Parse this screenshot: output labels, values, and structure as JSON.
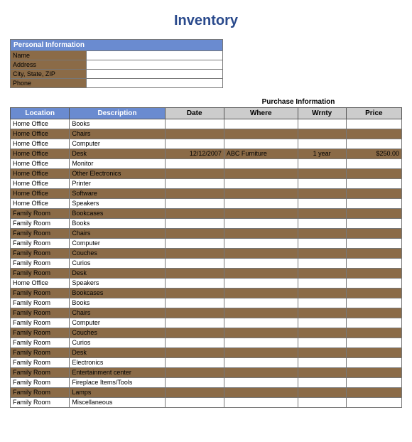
{
  "title": "Inventory",
  "personal_info": {
    "header": "Personal Information",
    "fields": [
      {
        "label": "Name",
        "value": ""
      },
      {
        "label": "Address",
        "value": ""
      },
      {
        "label": "City, State, ZIP",
        "value": ""
      },
      {
        "label": "Phone",
        "value": ""
      }
    ]
  },
  "purchase_info_header": "Purchase Information",
  "columns": {
    "location": "Location",
    "description": "Description",
    "date": "Date",
    "where": "Where",
    "wrnty": "Wrnty",
    "price": "Price"
  },
  "rows": [
    {
      "location": "Home Office",
      "description": "Books",
      "date": "",
      "where": "",
      "wrnty": "",
      "price": ""
    },
    {
      "location": "Home Office",
      "description": "Chairs",
      "date": "",
      "where": "",
      "wrnty": "",
      "price": ""
    },
    {
      "location": "Home Office",
      "description": "Computer",
      "date": "",
      "where": "",
      "wrnty": "",
      "price": ""
    },
    {
      "location": "Home Office",
      "description": "Desk",
      "date": "12/12/2007",
      "where": "ABC Furniture",
      "wrnty": "1 year",
      "price": "$250.00"
    },
    {
      "location": "Home Office",
      "description": "Monitor",
      "date": "",
      "where": "",
      "wrnty": "",
      "price": ""
    },
    {
      "location": "Home Office",
      "description": "Other Electronics",
      "date": "",
      "where": "",
      "wrnty": "",
      "price": ""
    },
    {
      "location": "Home Office",
      "description": "Printer",
      "date": "",
      "where": "",
      "wrnty": "",
      "price": ""
    },
    {
      "location": "Home Office",
      "description": "Software",
      "date": "",
      "where": "",
      "wrnty": "",
      "price": ""
    },
    {
      "location": "Home Office",
      "description": "Speakers",
      "date": "",
      "where": "",
      "wrnty": "",
      "price": ""
    },
    {
      "location": "Family Room",
      "description": "Bookcases",
      "date": "",
      "where": "",
      "wrnty": "",
      "price": ""
    },
    {
      "location": "Family Room",
      "description": "Books",
      "date": "",
      "where": "",
      "wrnty": "",
      "price": ""
    },
    {
      "location": "Family Room",
      "description": "Chairs",
      "date": "",
      "where": "",
      "wrnty": "",
      "price": ""
    },
    {
      "location": "Family Room",
      "description": "Computer",
      "date": "",
      "where": "",
      "wrnty": "",
      "price": ""
    },
    {
      "location": "Family Room",
      "description": "Couches",
      "date": "",
      "where": "",
      "wrnty": "",
      "price": ""
    },
    {
      "location": "Family Room",
      "description": "Curios",
      "date": "",
      "where": "",
      "wrnty": "",
      "price": ""
    },
    {
      "location": "Family Room",
      "description": "Desk",
      "date": "",
      "where": "",
      "wrnty": "",
      "price": ""
    },
    {
      "location": "Home Office",
      "description": "Speakers",
      "date": "",
      "where": "",
      "wrnty": "",
      "price": ""
    },
    {
      "location": "Family Room",
      "description": "Bookcases",
      "date": "",
      "where": "",
      "wrnty": "",
      "price": ""
    },
    {
      "location": "Family Room",
      "description": "Books",
      "date": "",
      "where": "",
      "wrnty": "",
      "price": ""
    },
    {
      "location": "Family Room",
      "description": "Chairs",
      "date": "",
      "where": "",
      "wrnty": "",
      "price": ""
    },
    {
      "location": "Family Room",
      "description": "Computer",
      "date": "",
      "where": "",
      "wrnty": "",
      "price": ""
    },
    {
      "location": "Family Room",
      "description": "Couches",
      "date": "",
      "where": "",
      "wrnty": "",
      "price": ""
    },
    {
      "location": "Family Room",
      "description": "Curios",
      "date": "",
      "where": "",
      "wrnty": "",
      "price": ""
    },
    {
      "location": "Family Room",
      "description": "Desk",
      "date": "",
      "where": "",
      "wrnty": "",
      "price": ""
    },
    {
      "location": "Family Room",
      "description": "Electronics",
      "date": "",
      "where": "",
      "wrnty": "",
      "price": ""
    },
    {
      "location": "Family Room",
      "description": "Entertainment center",
      "date": "",
      "where": "",
      "wrnty": "",
      "price": ""
    },
    {
      "location": "Family Room",
      "description": "Fireplace Items/Tools",
      "date": "",
      "where": "",
      "wrnty": "",
      "price": ""
    },
    {
      "location": "Family Room",
      "description": "Lamps",
      "date": "",
      "where": "",
      "wrnty": "",
      "price": ""
    },
    {
      "location": "Family Room",
      "description": "Miscellaneous",
      "date": "",
      "where": "",
      "wrnty": "",
      "price": ""
    }
  ]
}
